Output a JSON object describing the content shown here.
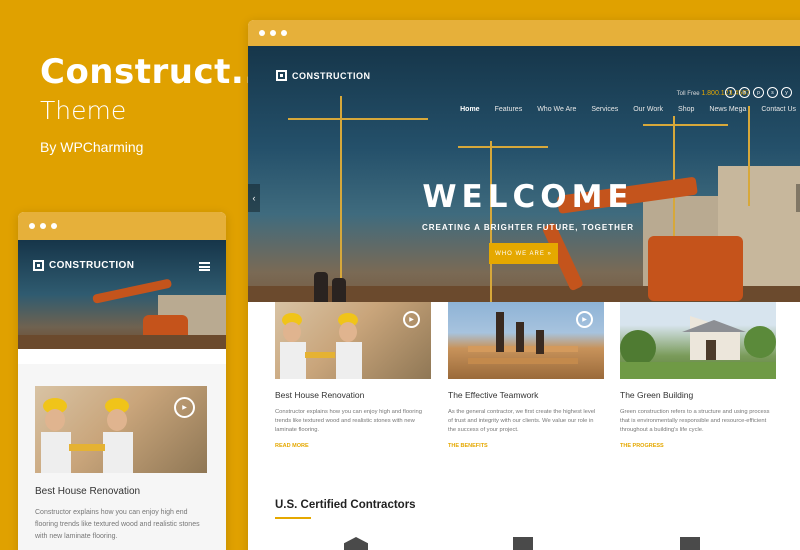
{
  "promo": {
    "title": "Construct..",
    "subtitle": "Theme",
    "byline": "By WPCharming"
  },
  "site": {
    "logo_text": "CONSTRUCTION",
    "tollfree_label": "Toll Free",
    "tollfree_number": "1.800.123.4567",
    "nav": [
      "Home",
      "Features",
      "Who We Are",
      "Services",
      "Our Work",
      "Shop",
      "News Mega",
      "Contact Us"
    ],
    "hero": {
      "heading": "WELCOME",
      "tagline": "CREATING A BRIGHTER FUTURE, TOGETHER",
      "cta": "WHO WE ARE »"
    },
    "features": [
      {
        "title": "Best House Renovation",
        "text": "Constructor explains how you can enjoy high and flooring trends like textured wood and realistic stones with new laminate flooring.",
        "link": "READ MORE"
      },
      {
        "title": "The Effective Teamwork",
        "text": "As the general contractor, we first create the highest level of trust and integrity with our clients. We value our role in the success of your project.",
        "link": "THE BENEFITS"
      },
      {
        "title": "The Green Building",
        "text": "Green construction refers to a structure and using process that is environmentally responsible and resource-efficient throughout a building's life cycle.",
        "link": "THE PROGRESS"
      }
    ],
    "section_title": "U.S. Certified Contractors"
  },
  "mobile": {
    "logo_text": "CONSTRUCTION",
    "card_title": "Best House Renovation",
    "card_text": "Constructor explains how you can enjoy high end flooring trends like textured wood and realistic stones with new laminate flooring."
  },
  "colors": {
    "background": "#e0a100",
    "accent": "#e5a800",
    "window_bar": "#e6b03a"
  }
}
